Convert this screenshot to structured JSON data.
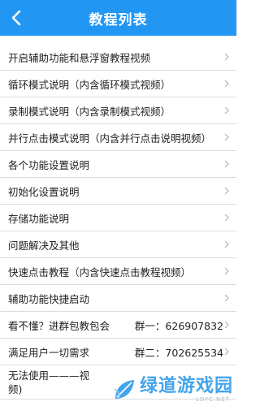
{
  "header": {
    "title": "教程列表",
    "back_icon": "chevron-left-icon",
    "bg_color": "#2196f3"
  },
  "list": {
    "items": [
      {
        "label": "开启辅助功能和悬浮窗教程视频"
      },
      {
        "label": "循环模式说明（内含循环模式视频）"
      },
      {
        "label": "录制模式说明（内含录制模式视频）"
      },
      {
        "label": "并行点击模式说明（内含并行点击说明视频）"
      },
      {
        "label": "各个功能设置说明"
      },
      {
        "label": "初始化设置说明"
      },
      {
        "label": "存储功能说明"
      },
      {
        "label": "问题解决及其他"
      },
      {
        "label": "快速点击教程（内含快速点击教程视频）"
      },
      {
        "label": "辅助功能快捷启动"
      }
    ],
    "group_rows": [
      {
        "label": "看不懂？进群包教包会",
        "group": "群一：626907832"
      },
      {
        "label": "满足用户一切需求",
        "group": "群二：702625534"
      }
    ],
    "last_item": {
      "label": "无法使用———视频)"
    }
  },
  "watermark": {
    "text": "绿道游戏园",
    "sub": "LDYC.NET",
    "color": "#2f9bea"
  }
}
